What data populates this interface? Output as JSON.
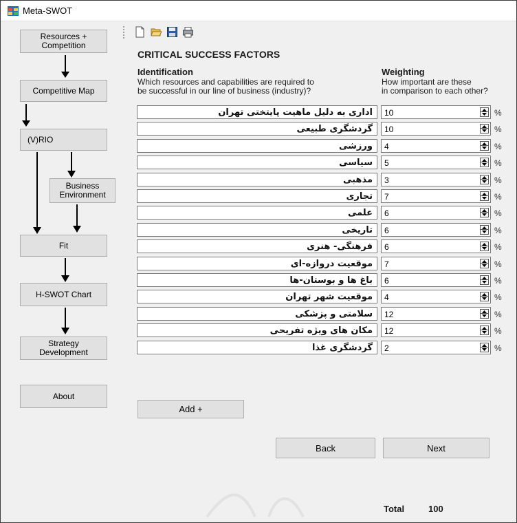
{
  "window": {
    "title": "Meta-SWOT"
  },
  "sidebar": {
    "resources_competition": "Resources + Competition",
    "competitive_map": "Competitive Map",
    "vrio": "(V)RIO",
    "business_environment": "Business Environment",
    "fit": "Fit",
    "hswot_chart": "H-SWOT Chart",
    "strategy_development": "Strategy Development",
    "about": "About"
  },
  "toolbar": {
    "icons": [
      "new-document-icon",
      "open-folder-icon",
      "save-disk-icon",
      "print-icon"
    ]
  },
  "main": {
    "heading": "CRITICAL SUCCESS FACTORS",
    "identification_title": "Identification",
    "identification_desc_line1": "Which resources and capabilities are required to",
    "identification_desc_line2": "be successful in our line of business (industry)?",
    "weighting_title": "Weighting",
    "weighting_desc_line1": "How important are these",
    "weighting_desc_line2": "in comparison to each other?",
    "percent_symbol": "%",
    "factors": [
      {
        "name": "اداری به دلیل ماهیت پایتختی تهران",
        "weight": "10"
      },
      {
        "name": "گردشگری طبیعی",
        "weight": "10"
      },
      {
        "name": "ورزشی",
        "weight": "4"
      },
      {
        "name": "سیاسی",
        "weight": "5"
      },
      {
        "name": "مذهبی",
        "weight": "3"
      },
      {
        "name": "تجاری",
        "weight": "7"
      },
      {
        "name": "علمی",
        "weight": "6"
      },
      {
        "name": "تاریخی",
        "weight": "6"
      },
      {
        "name": "فرهنگی- هنری",
        "weight": "6"
      },
      {
        "name": "موقعیت دروازه-ای",
        "weight": "7"
      },
      {
        "name": "باغ ها و بوستان-ها",
        "weight": "6"
      },
      {
        "name": "موقعیت شهر تهران",
        "weight": "4"
      },
      {
        "name": "سلامتی و پزشکی",
        "weight": "12"
      },
      {
        "name": "مکان های ویژه تفریحی",
        "weight": "12"
      },
      {
        "name": "گردشگری غذا",
        "weight": "2"
      }
    ],
    "add_button": "Add +",
    "back_button": "Back",
    "next_button": "Next",
    "total_label": "Total",
    "total_value": "100"
  }
}
